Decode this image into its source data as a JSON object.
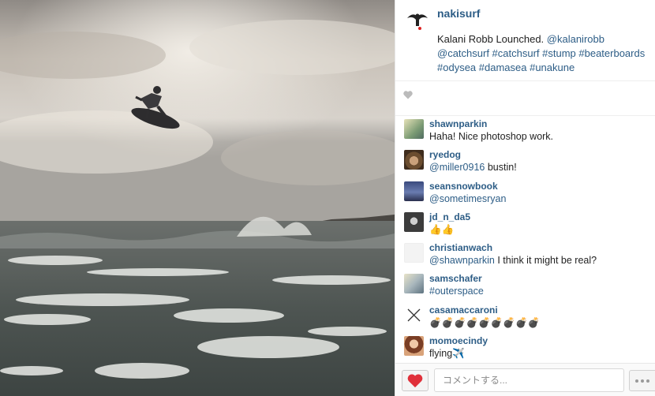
{
  "post": {
    "username": "nakisurf",
    "caption_text": "Kalani Robb Lounched. ",
    "caption_tags": "@kalanirobb @catchsurf #catchsurf #stump #beaterboards #odysea #damasea #unakune"
  },
  "comments": [
    {
      "user": "shawnparkin",
      "mention": "",
      "text": "Haha! Nice photoshop work.",
      "avatar_color": "#8aa27a"
    },
    {
      "user": "ryedog",
      "mention": "@miller0916",
      "text": " bustin!",
      "avatar_color": "#8b6a45"
    },
    {
      "user": "seansnowbook",
      "mention": "@sometimesryan",
      "text": "",
      "avatar_color": "#4a5a88"
    },
    {
      "user": "jd_n_da5",
      "mention": "",
      "text": "👍👍",
      "avatar_color": "#555"
    },
    {
      "user": "christianwach",
      "mention": "@shawnparkin",
      "text": " I think it might be real?",
      "avatar_color": "#f2f2f2"
    },
    {
      "user": "samschafer",
      "mention": "#outerspace",
      "text": "",
      "avatar_color": "#b8c2c8"
    },
    {
      "user": "casamaccaroni",
      "mention": "",
      "text": "💣💣💣💣💣💣💣💣💣",
      "avatar_color": "#ffffff"
    },
    {
      "user": "momoecindy",
      "mention": "",
      "text": "flying✈️",
      "avatar_color": "#c46a3a"
    }
  ],
  "footer": {
    "comment_placeholder": "コメントする..."
  },
  "icons": {
    "like": "heart-icon",
    "more": "more-dots-icon",
    "likes_row": "heart-mini-icon"
  },
  "colors": {
    "link": "#2d5d86",
    "heart": "#e0303a"
  }
}
